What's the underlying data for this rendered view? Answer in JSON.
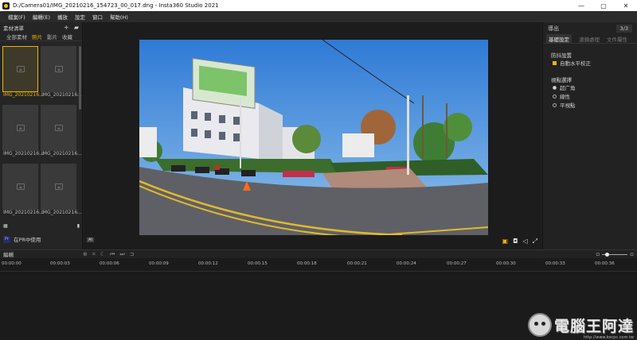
{
  "window": {
    "title": "D:/Camera01/IMG_20210216_154723_00_017.dng - Insta360 Studio 2021"
  },
  "menu": [
    "檔案(F)",
    "編輯(E)",
    "播放",
    "設定",
    "窗口",
    "幫助(H)"
  ],
  "library": {
    "title": "素材清單",
    "add_icon": "plus-icon",
    "tabs": [
      {
        "label": "全部素材",
        "active": false
      },
      {
        "label": "照片",
        "active": true
      },
      {
        "label": "影片",
        "active": false
      },
      {
        "label": "收藏",
        "active": false
      }
    ],
    "items": [
      {
        "label": "IMG_20210216...",
        "selected": true
      },
      {
        "label": "IMG_20210216...",
        "selected": false
      },
      {
        "label": "IMG_20210216...",
        "selected": false
      },
      {
        "label": "IMG_20210216...",
        "selected": false
      },
      {
        "label": "IMG_20210216...",
        "selected": false
      },
      {
        "label": "IMG_20210216...",
        "selected": false
      }
    ],
    "pr_button": {
      "badge": "Pr",
      "label": "在PR中使用"
    }
  },
  "viewer": {
    "badge": "AI"
  },
  "inspector": {
    "export_label": "導出",
    "count": "3/3",
    "tabs": [
      {
        "label": "基礎設定",
        "active": true
      },
      {
        "label": "濾鏡處理",
        "active": false
      },
      {
        "label": "文件屬性",
        "active": false
      }
    ],
    "anti_shake": {
      "section": "防抖設置",
      "checkbox_label": "自動水平校正",
      "checked": true
    },
    "view_mode": {
      "section": "視點選擇",
      "options": [
        {
          "label": "超广角",
          "selected": true
        },
        {
          "label": "線性",
          "selected": false
        },
        {
          "label": "平視點",
          "selected": false
        }
      ]
    }
  },
  "timeline": {
    "title": "編輯",
    "ticks": [
      "00:00:00",
      "00:00:03",
      "00:00:06",
      "00:00:09",
      "00:00:12",
      "00:00:15",
      "00:00:18",
      "00:00:21",
      "00:00:24",
      "00:00:27",
      "00:00:30",
      "00:00:33",
      "00:00:36"
    ]
  },
  "watermark": {
    "text": "電腦王阿達",
    "url": "http://www.kocpc.com.tw"
  }
}
